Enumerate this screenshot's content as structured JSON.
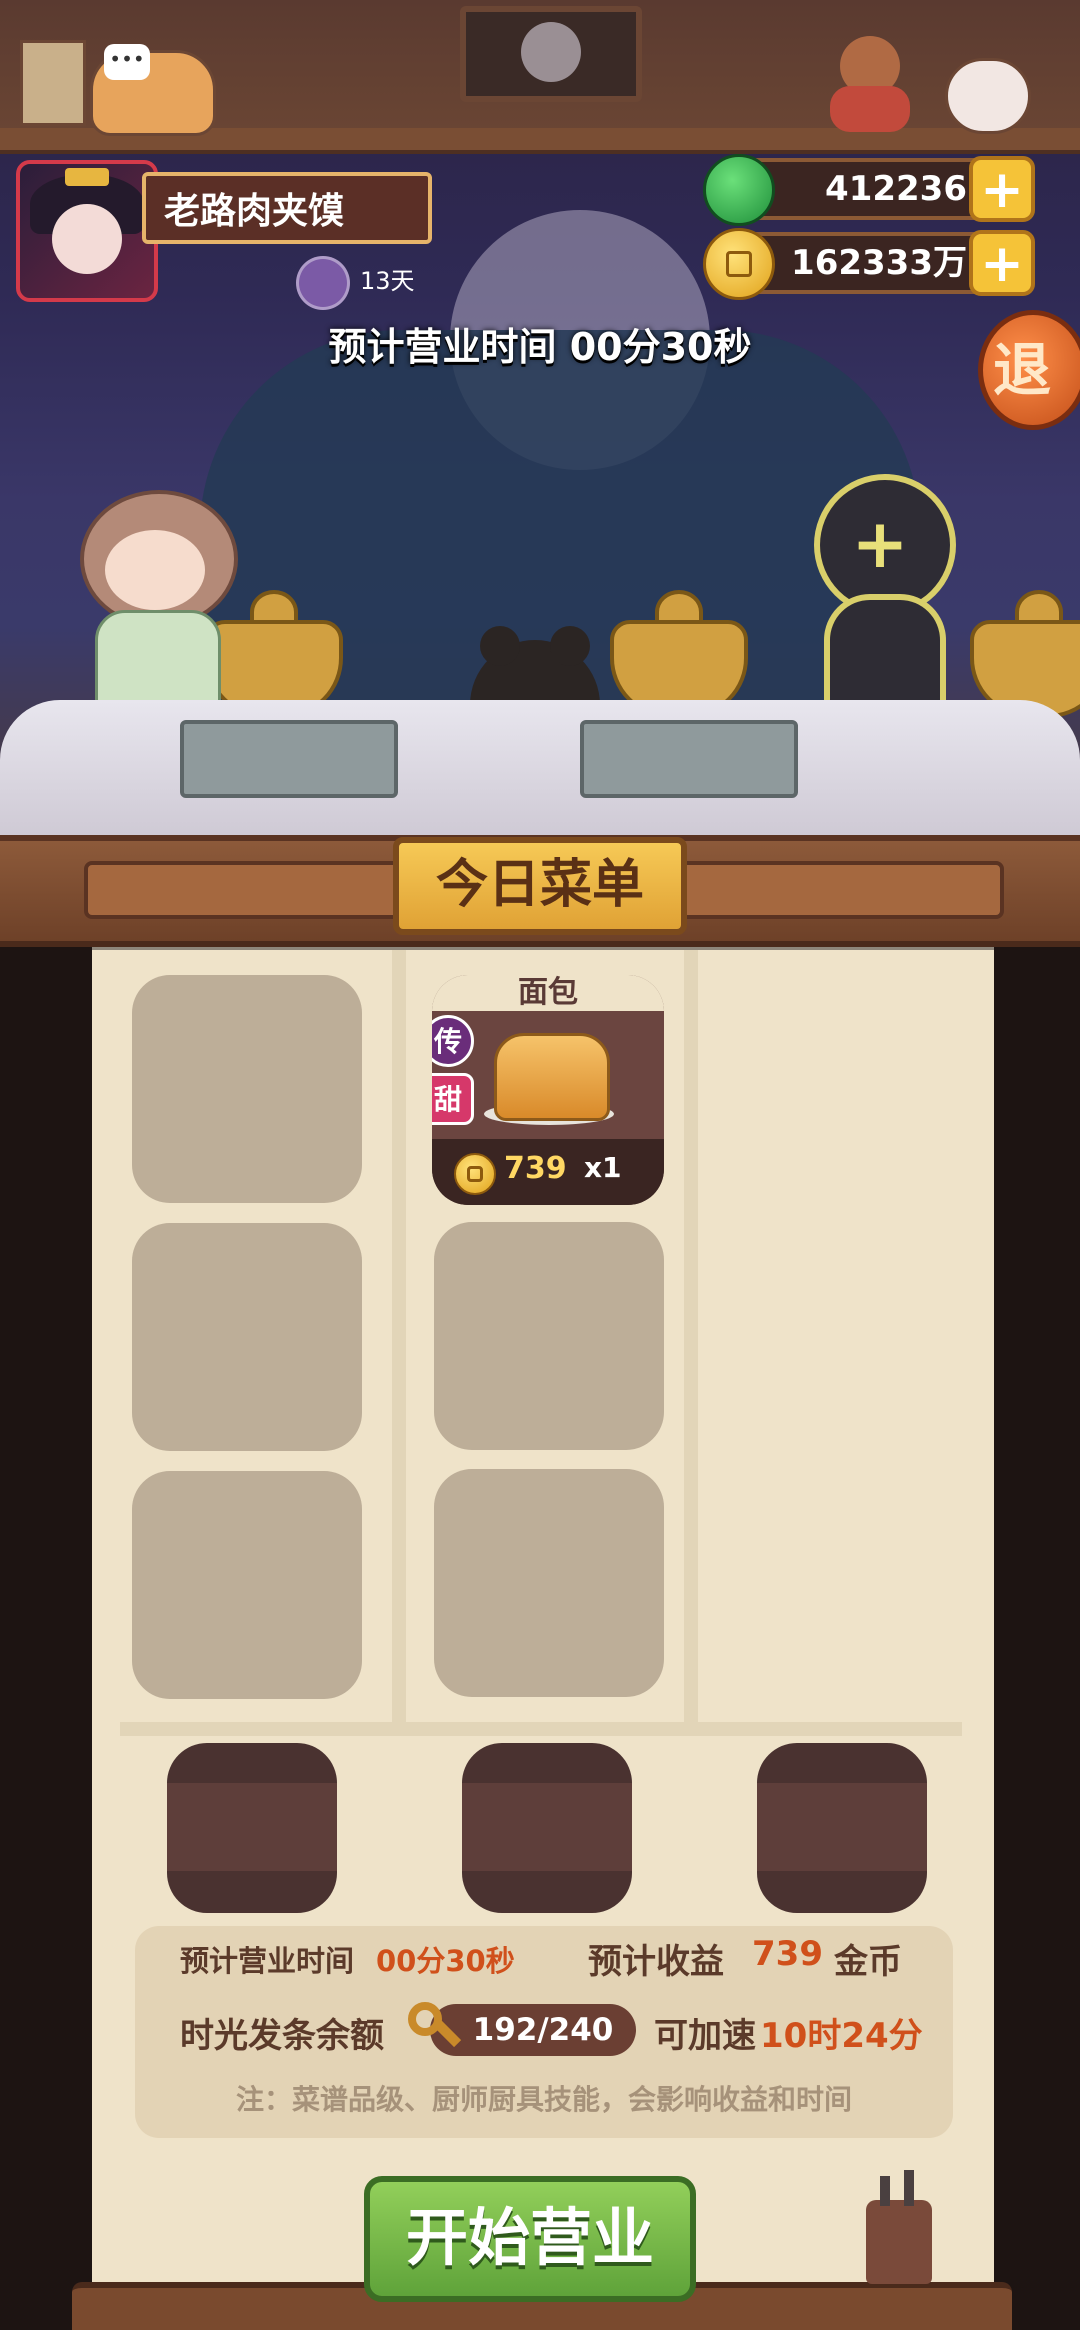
{
  "player": {
    "name": "老路肉夹馍",
    "days": "13天"
  },
  "currencies": {
    "jade": {
      "icon": "jade-coin-icon",
      "value": "412236"
    },
    "coin": {
      "icon": "gold-coin-icon",
      "value": "162333万"
    }
  },
  "header": {
    "estimated_time_text": "预计营业时间  00分30秒",
    "exit_label": "退"
  },
  "scene": {
    "empty_staff_slot_plus": "+"
  },
  "menu": {
    "title": "今日菜单",
    "dishes": [
      {
        "name": "面包",
        "tag_grade": "传",
        "tag_flavor": "甜",
        "price": "739",
        "quantity": "x1"
      }
    ]
  },
  "summary": {
    "est_time_label": "预计营业时间",
    "est_time_value": "00分30秒",
    "est_income_label": "预计收益",
    "est_income_value": "739",
    "est_income_unit": "金币",
    "clockwork_label": "时光发条余额",
    "clockwork_value": "192/240",
    "speedup_label": "可加速",
    "speedup_value": "10时24分",
    "note": "注：菜谱品级、厨师厨具技能，会影响收益和时间"
  },
  "actions": {
    "start_label": "开始营业"
  },
  "colors": {
    "accent": "#d0501b",
    "start_button": "#7fbf4c",
    "title_badge": "#f0b845",
    "panel": "#efe3c9"
  }
}
